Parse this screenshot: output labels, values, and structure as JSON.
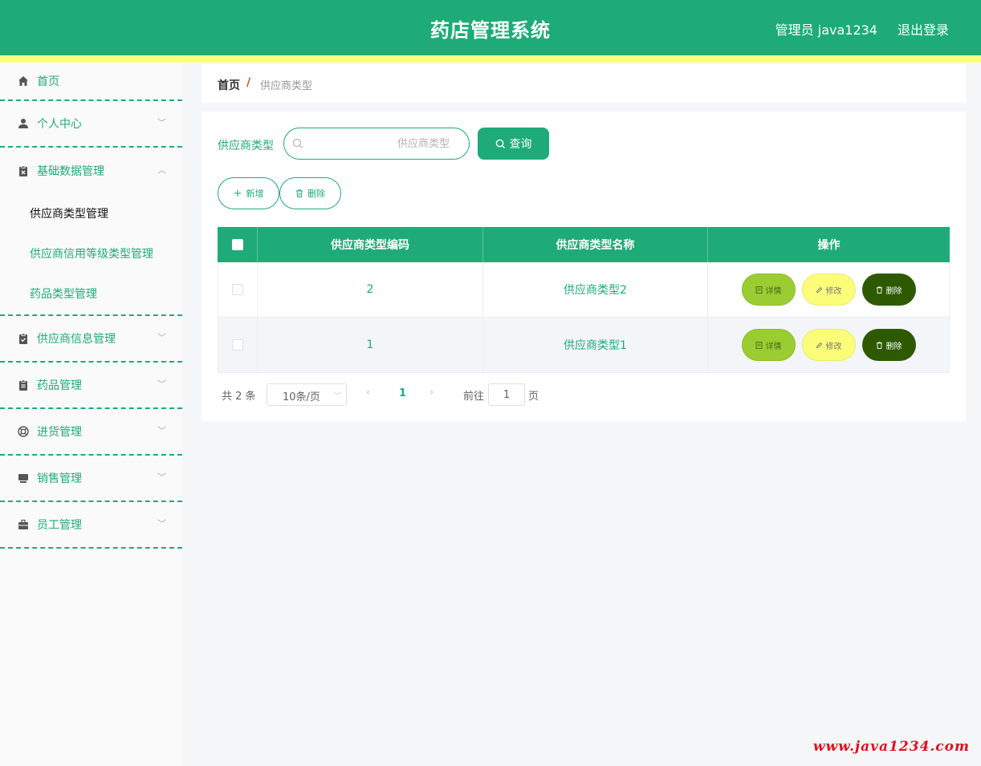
{
  "header": {
    "title": "药店管理系统",
    "user": "管理员 java1234",
    "logout": "退出登录"
  },
  "sidebar": {
    "home": "首页",
    "personal": "个人中心",
    "basic": "基础数据管理",
    "basic_sub": [
      "供应商类型管理",
      "供应商信用等级类型管理",
      "药品类型管理"
    ],
    "supplier": "供应商信息管理",
    "drug": "药品管理",
    "purchase": "进货管理",
    "sales": "销售管理",
    "staff": "员工管理"
  },
  "breadcrumb": {
    "home": "首页",
    "sep": "/",
    "current": "供应商类型"
  },
  "search": {
    "label": "供应商类型",
    "placeholder": "供应商类型",
    "value": "",
    "button": "查询"
  },
  "actions": {
    "add": "新增",
    "delete": "删除"
  },
  "table": {
    "headers": [
      "供应商类型编码",
      "供应商类型名称",
      "操作"
    ],
    "rows": [
      {
        "code": "2",
        "name": "供应商类型2"
      },
      {
        "code": "1",
        "name": "供应商类型1"
      }
    ],
    "op_detail": "详情",
    "op_edit": "修改",
    "op_delete": "删除"
  },
  "pagination": {
    "total": "共 2 条",
    "page_size": "10条/页",
    "current": "1",
    "goto_label": "前往",
    "goto_value": "1",
    "page_label": "页"
  },
  "watermark": "www.java1234.com",
  "colors": {
    "primary": "#1eab78",
    "stripe": "#f8ff80",
    "detail": "#9acd32",
    "edit": "#fbfc78",
    "delete": "#2d5a00",
    "watermark": "#e0101f"
  }
}
